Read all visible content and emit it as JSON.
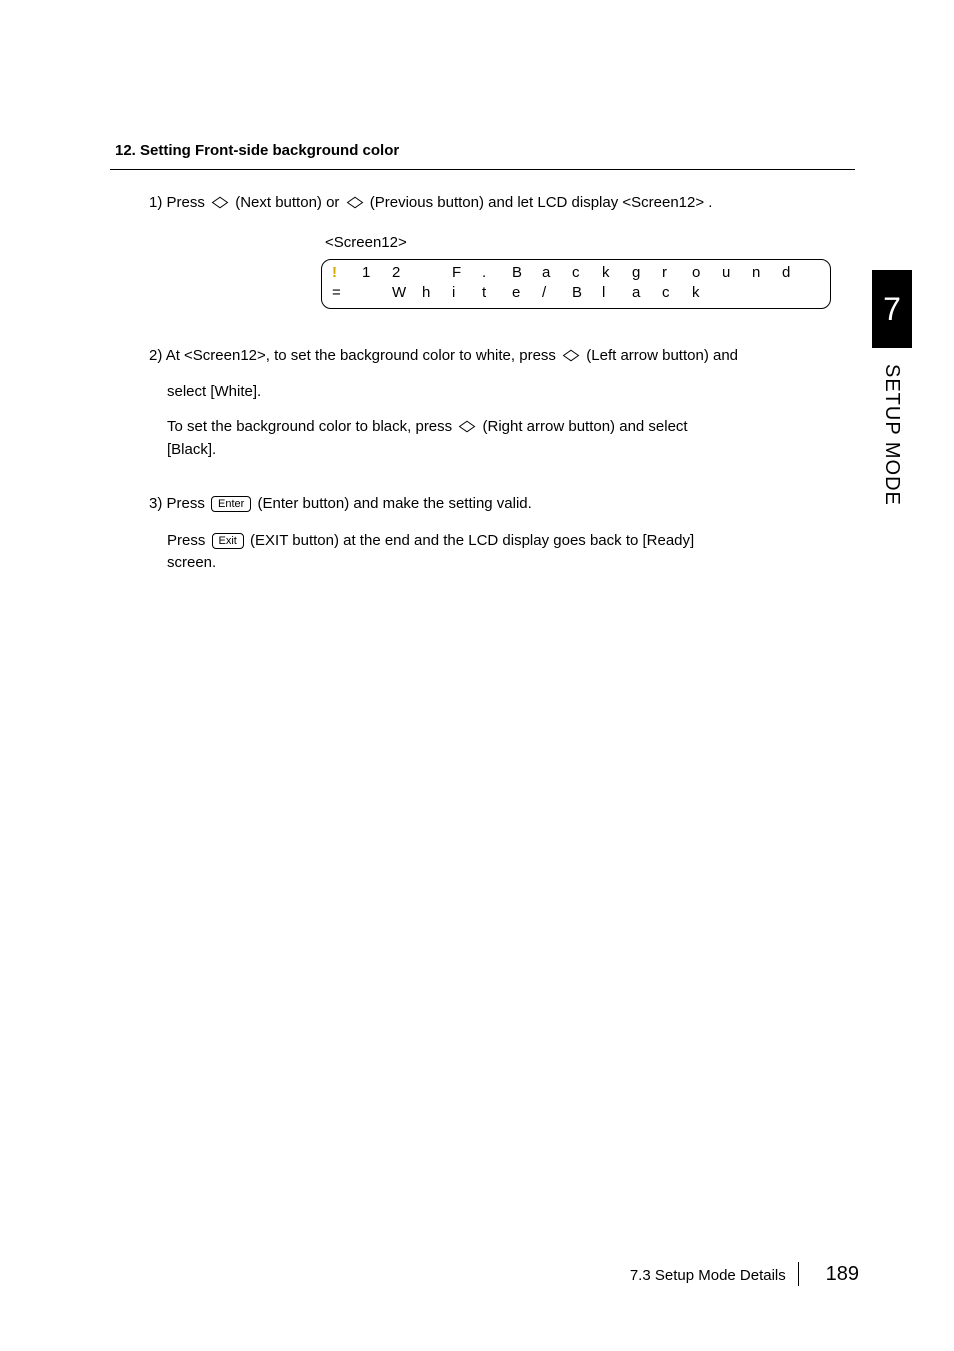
{
  "heading": "12. Setting Front-side background color",
  "step1": {
    "num": "1)",
    "before": "Press ",
    "next_button": "(Next button) or ",
    "prev_button": " (Previous button) and let LCD display <Screen12> ."
  },
  "lcd": {
    "label": "<Screen12>",
    "row1": [
      "!",
      "1",
      "2",
      "",
      "F",
      ".",
      "B",
      "a",
      "c",
      "k",
      "g",
      "r",
      "o",
      "u",
      "n",
      "d"
    ],
    "row2": [
      "=",
      "",
      "W",
      "h",
      "i",
      "t",
      "e",
      "/",
      "B",
      "l",
      "a",
      "c",
      "k",
      "",
      "",
      ""
    ]
  },
  "step2": {
    "num": "2)",
    "line1a": "At <Screen12>, to set the background color to white, press ",
    "line1b": "(Left arrow button) and",
    "line2": "select [White].",
    "line3a": "To set the background color to black, press ",
    "line3b": "(Right arrow button) and select",
    "line4": "[Black]."
  },
  "step3": {
    "num": "3)",
    "line1a": "Press ",
    "enter_label": "Enter",
    "line1b": "(Enter button) and make the setting valid.",
    "line2a": "Press ",
    "exit_label": "Exit",
    "line2b": " (EXIT button) at the end and the LCD display goes back to [Ready]",
    "line3": "screen."
  },
  "side_tab": {
    "num": "7",
    "label": "SETUP MODE"
  },
  "footer": {
    "section": "7.3  Setup Mode Details",
    "page": "189"
  }
}
